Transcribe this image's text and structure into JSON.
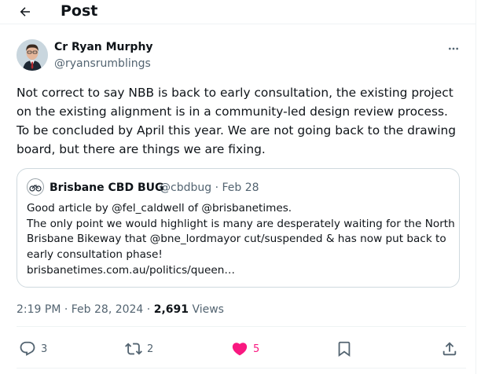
{
  "header": {
    "title": "Post"
  },
  "author": {
    "name": "Cr Ryan Murphy",
    "handle": "@ryansrumblings"
  },
  "post": {
    "lines": [
      "Not correct to say NBB is back to early consultation, the existing project",
      "on the existing alignment is in a community-led design review process.",
      "To be concluded by April this year. We are not going back to the drawing",
      "board, but there are things we are fixing."
    ]
  },
  "quote": {
    "name": "Brisbane CBD BUG",
    "meta": "@cbdbug · Feb 28",
    "lines": [
      "Good article by @fel_caldwell of @brisbanetimes.",
      "The only point we would highlight is many are desperately waiting for the North",
      "Brisbane Bikeway that @bne_lordmayor cut/suspended & has now put back to",
      "early consultation phase!",
      "brisbanetimes.com.au/politics/queen…"
    ]
  },
  "timestamp": {
    "time": "2:19 PM · Feb 28, 2024 · ",
    "views_count": "2,691",
    "views_label": " Views"
  },
  "actions": {
    "replies": "3",
    "reposts": "2",
    "likes": "5"
  },
  "colors": {
    "like": "#f91880",
    "muted": "#536471",
    "text": "#0f1419"
  }
}
